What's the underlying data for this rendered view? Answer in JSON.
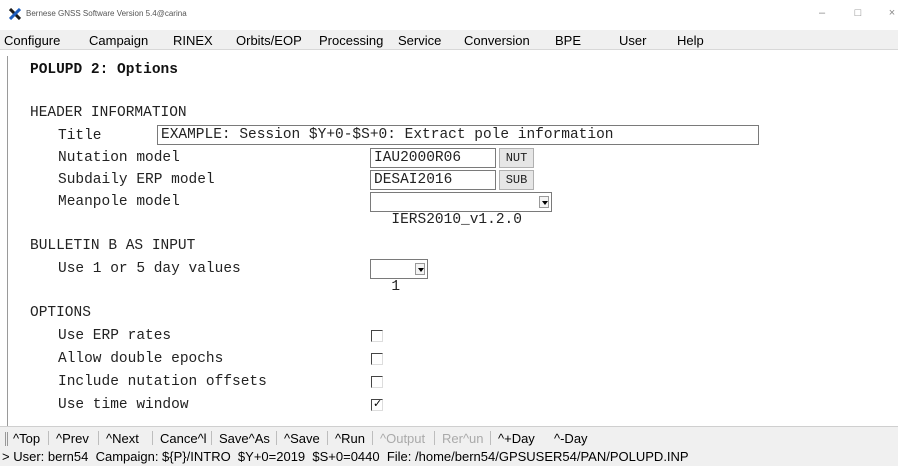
{
  "window": {
    "title": "Bernese GNSS Software Version 5.4@carina",
    "app_icon": "x-logo-icon",
    "controls": {
      "minimize": "–",
      "maximize": "□",
      "close": "×"
    }
  },
  "menu": {
    "items": [
      "Configure",
      "Campaign",
      "RINEX",
      "Orbits/EOP",
      "Processing",
      "Service",
      "Conversion",
      "BPE",
      "User",
      "Help"
    ]
  },
  "panel": {
    "title": "POLUPD 2: Options",
    "header_section": {
      "heading": "HEADER INFORMATION",
      "title_label": "Title",
      "title_value": "EXAMPLE: Session $Y+0-$S+0: Extract pole information",
      "nutation_label": "Nutation model",
      "nutation_value": "IAU2000R06",
      "nutation_button": "NUT",
      "subdaily_label": "Subdaily ERP model",
      "subdaily_value": "DESAI2016",
      "subdaily_button": "SUB",
      "meanpole_label": "Meanpole model",
      "meanpole_value": "IERS2010_v1.2.0"
    },
    "bulletin_section": {
      "heading": "BULLETIN B AS INPUT",
      "day_values_label": "Use 1 or 5 day values",
      "day_values_value": "1"
    },
    "options_section": {
      "heading": "OPTIONS",
      "items": [
        {
          "label": "Use ERP rates",
          "checked": false
        },
        {
          "label": "Allow double epochs",
          "checked": false
        },
        {
          "label": "Include nutation offsets",
          "checked": false
        },
        {
          "label": "Use time window",
          "checked": true
        }
      ]
    }
  },
  "bottom_bar": {
    "items": [
      {
        "label": "^Top",
        "enabled": true
      },
      {
        "label": "^Prev",
        "enabled": true
      },
      {
        "label": "^Next",
        "enabled": true
      },
      {
        "label": "Cance^l",
        "enabled": true
      },
      {
        "label": "Save^As",
        "enabled": true
      },
      {
        "label": "^Save",
        "enabled": true
      },
      {
        "label": "^Run",
        "enabled": true
      },
      {
        "label": "^Output",
        "enabled": false
      },
      {
        "label": "Rer^un",
        "enabled": false
      },
      {
        "label": "^+Day",
        "enabled": true
      },
      {
        "label": "^-Day",
        "enabled": true
      }
    ]
  },
  "status": {
    "text": "> User: bern54  Campaign: ${P}/INTRO  $Y+0=2019  $S+0=0440  File: /home/bern54/GPSUSER54/PAN/POLUPD.INP"
  },
  "colors": {
    "menubar_bg": "#f0f0f0",
    "disabled_text": "#aaaaaa",
    "logo_dark": "#1a1a1a",
    "logo_blue": "#1f5fbf"
  }
}
